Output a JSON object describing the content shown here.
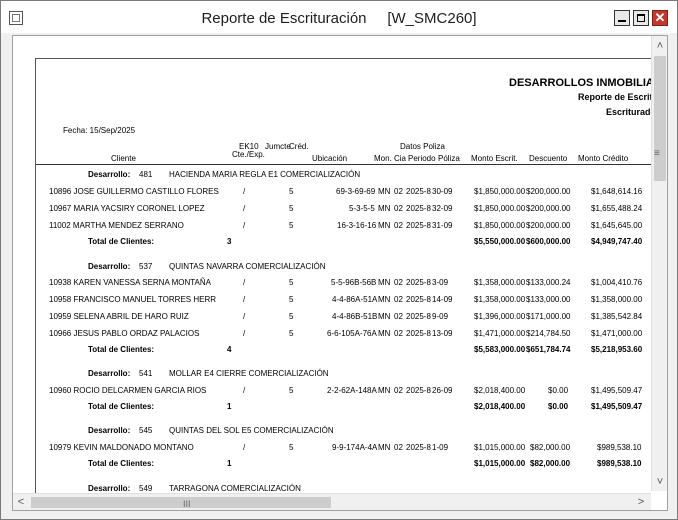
{
  "window": {
    "title": "Reporte de Escrituración     [W_SMC260]",
    "close_glyph": "✕"
  },
  "report": {
    "company": "DESARROLLOS INMOBILIARIO",
    "subtitle1": "Reporte de Escritu",
    "subtitle2": "Escriturados",
    "fecha": "Fecha: 15/Sep/2025",
    "headers": {
      "cliente": "Cliente",
      "ek10": "EK10",
      "cte_exp": "Cte./Exp.",
      "jumcte": "Jumcte",
      "cred": "Créd.",
      "ubicacion": "Ubicación",
      "datos_poliza": "Datos Poliza",
      "mon": "Mon.",
      "cia": "Cia",
      "periodo": "Periodo",
      "poliza": "Póliza",
      "monto_escrit": "Monto Escrit.",
      "descuento": "Descuento",
      "monto_credito": "Monto Crédito"
    },
    "desarrollo_label": "Desarrollo:",
    "total_label": "Total de Clientes:",
    "groups": [
      {
        "id": "481",
        "name": "HACIENDA MARIA REGLA E1 COMERCIALIZACIÓN",
        "rows": [
          {
            "cliente": "10896 JOSE GUILLERMO CASTILLO FLORES",
            "slash": "/",
            "cred": "5",
            "ubicacion": "69-3-69-69",
            "mon": "MN",
            "cia": "02",
            "periodo": "2025-8",
            "poliza": "30-09",
            "monto": "$1,850,000.00",
            "descuento": "$200,000.00",
            "credito": "$1,648,614.16"
          },
          {
            "cliente": "10967 MARIA YACSIRY CORONEL LOPEZ",
            "slash": "/",
            "cred": "5",
            "ubicacion": "5-3-5-5",
            "mon": "MN",
            "cia": "02",
            "periodo": "2025-8",
            "poliza": "32-09",
            "monto": "$1,850,000.00",
            "descuento": "$200,000.00",
            "credito": "$1,655,488.24"
          },
          {
            "cliente": "11002 MARTHA MENDEZ SERRANO",
            "slash": "/",
            "cred": "5",
            "ubicacion": "16-3-16-16",
            "mon": "MN",
            "cia": "02",
            "periodo": "2025-8",
            "poliza": "31-09",
            "monto": "$1,850,000.00",
            "descuento": "$200,000.00",
            "credito": "$1,645,645.00"
          }
        ],
        "total": {
          "count": "3",
          "monto": "$5,550,000.00",
          "descuento": "$600,000.00",
          "credito": "$4,949,747.40"
        }
      },
      {
        "id": "537",
        "name": "QUINTAS NAVARRA COMERCIALIZACIÓN",
        "rows": [
          {
            "cliente": "10938 KAREN VANESSA SERNA MONTAÑA",
            "slash": "/",
            "cred": "5",
            "ubicacion": "5-5-96B-56B",
            "mon": "MN",
            "cia": "02",
            "periodo": "2025-8",
            "poliza": "3-09",
            "monto": "$1,358,000.00",
            "descuento": "$133,000.24",
            "credito": "$1,004,410.76"
          },
          {
            "cliente": "10958 FRANCISCO MANUEL TORRES HERR",
            "slash": "/",
            "cred": "5",
            "ubicacion": "4-4-86A-51A",
            "mon": "MN",
            "cia": "02",
            "periodo": "2025-8",
            "poliza": "14-09",
            "monto": "$1,358,000.00",
            "descuento": "$133,000.00",
            "credito": "$1,358,000.00"
          },
          {
            "cliente": "10959 SELENA ABRIL DE HARO RUIZ",
            "slash": "/",
            "cred": "5",
            "ubicacion": "4-4-86B-51B",
            "mon": "MN",
            "cia": "02",
            "periodo": "2025-8",
            "poliza": "9-09",
            "monto": "$1,396,000.00",
            "descuento": "$171,000.00",
            "credito": "$1,385,542.84"
          },
          {
            "cliente": "10966 JESUS PABLO ORDAZ PALACIOS",
            "slash": "/",
            "cred": "5",
            "ubicacion": "6-6-105A-76A",
            "mon": "MN",
            "cia": "02",
            "periodo": "2025-8",
            "poliza": "13-09",
            "monto": "$1,471,000.00",
            "descuento": "$214,784.50",
            "credito": "$1,471,000.00"
          }
        ],
        "total": {
          "count": "4",
          "monto": "$5,583,000.00",
          "descuento": "$651,784.74",
          "credito": "$5,218,953.60"
        }
      },
      {
        "id": "541",
        "name": "MOLLAR E4 CIERRE COMERCIALIZACIÓN",
        "rows": [
          {
            "cliente": "10960 ROCIO DELCARMEN GARCIA RIOS",
            "slash": "/",
            "cred": "5",
            "ubicacion": "2-2-62A-148A",
            "mon": "MN",
            "cia": "02",
            "periodo": "2025-8",
            "poliza": "26-09",
            "monto": "$2,018,400.00",
            "descuento": "$0.00",
            "credito": "$1,495,509.47"
          }
        ],
        "total": {
          "count": "1",
          "monto": "$2,018,400.00",
          "descuento": "$0.00",
          "credito": "$1,495,509.47"
        }
      },
      {
        "id": "545",
        "name": "QUINTAS DEL SOL E5 COMERCIALIZACIÓN",
        "rows": [
          {
            "cliente": "10979 KEVIN MALDONADO MONTANO",
            "slash": "/",
            "cred": "5",
            "ubicacion": "9-9-174A-4A",
            "mon": "MN",
            "cia": "02",
            "periodo": "2025-8",
            "poliza": "1-09",
            "monto": "$1,015,000.00",
            "descuento": "$82,000.00",
            "credito": "$989,538.10"
          }
        ],
        "total": {
          "count": "1",
          "monto": "$1,015,000.00",
          "descuento": "$82,000.00",
          "credito": "$989,538.10"
        }
      },
      {
        "id": "549",
        "name": "TARRAGONA COMERCIALIZACIÓN",
        "rows": [],
        "total": null
      }
    ]
  },
  "scrollbars": {
    "up": "˄",
    "down": "˅",
    "left": "<",
    "right": ">",
    "vgrip": "≡",
    "hgrip": "III"
  }
}
